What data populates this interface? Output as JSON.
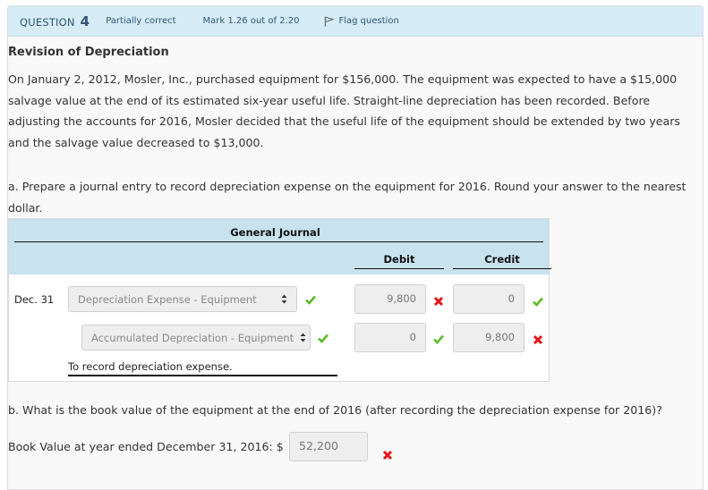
{
  "header": {
    "question_label": "QUESTION",
    "question_number": "4",
    "status": "Partially correct",
    "mark": "Mark 1.26 out of 2.20",
    "flag_label": "Flag question"
  },
  "problem": {
    "title": "Revision of Depreciation",
    "text": "On January 2, 2012, Mosler, Inc., purchased equipment for $156,000. The equipment was expected to have a $15,000 salvage value at the end of its estimated six-year useful life. Straight-line depreciation has been recorded. Before adjusting the accounts for 2016, Mosler decided that the useful life of the equipment should be extended by two years and the salvage value decreased to $13,000."
  },
  "part_a": {
    "prompt": "a. Prepare a journal entry to record depreciation expense on the equipment for 2016. Round your answer to the nearest dollar.",
    "journal": {
      "title": "General Journal",
      "debit_header": "Debit",
      "credit_header": "Credit",
      "rows": [
        {
          "date": "Dec. 31",
          "account": "Depreciation Expense - Equipment",
          "account_mark": "correct",
          "debit": "9,800",
          "debit_mark": "incorrect",
          "credit": "0",
          "credit_mark": "correct"
        },
        {
          "date": "",
          "account": "Accumulated Depreciation - Equipment",
          "account_mark": "correct",
          "debit": "0",
          "debit_mark": "correct",
          "credit": "9,800",
          "credit_mark": "incorrect"
        }
      ],
      "memo": "To record depreciation expense."
    }
  },
  "part_b": {
    "prompt": "b. What is the book value of the equipment at the end of 2016 (after recording the depreciation expense for 2016)?",
    "label": "Book Value at year ended December 31, 2016: $",
    "value": "52,200",
    "mark": "incorrect"
  },
  "colors": {
    "header_bg": "#d6ecf6",
    "correct": "#5cb82a",
    "incorrect": "#e8151b"
  }
}
